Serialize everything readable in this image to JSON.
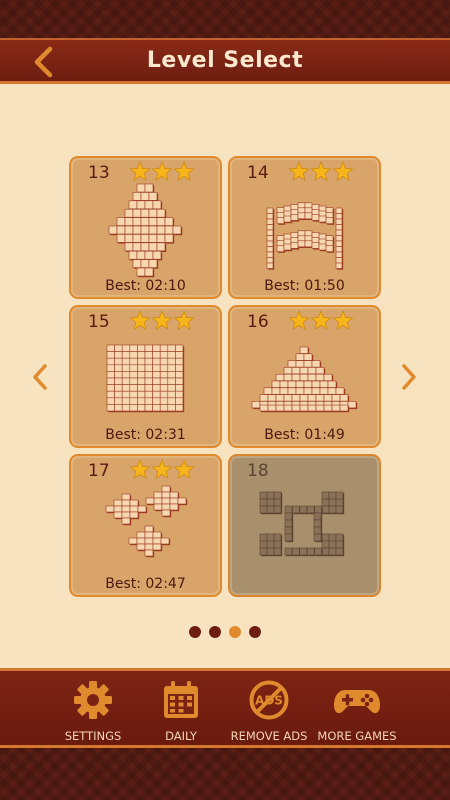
{
  "header": {
    "title": "Level Select"
  },
  "colors": {
    "accent": "#e08a2e",
    "header_bg": "#7a2214",
    "page_bg": "#f8e3c0",
    "star": "#f7b51c",
    "tile": "#f6d7b0"
  },
  "levels": [
    {
      "number": "13",
      "stars": 3,
      "best": "Best: 02:10",
      "locked": false,
      "layout": "diamond"
    },
    {
      "number": "14",
      "stars": 3,
      "best": "Best: 01:50",
      "locked": false,
      "layout": "stairs"
    },
    {
      "number": "15",
      "stars": 3,
      "best": "Best: 02:31",
      "locked": false,
      "layout": "square"
    },
    {
      "number": "16",
      "stars": 3,
      "best": "Best: 01:49",
      "locked": false,
      "layout": "pyramid"
    },
    {
      "number": "17",
      "stars": 3,
      "best": "Best: 02:47",
      "locked": false,
      "layout": "clusters"
    },
    {
      "number": "18",
      "stars": 0,
      "best": "",
      "locked": true,
      "layout": "frame"
    }
  ],
  "pagination": {
    "pages": 4,
    "current": 3
  },
  "footer": {
    "settings": "SETTINGS",
    "daily": "DAILY",
    "remove_ads": "REMOVE ADS",
    "more_games": "MORE GAMES",
    "ads_icon_text": "ADS"
  },
  "icons": [
    "back-arrow-icon",
    "left-arrow-icon",
    "right-arrow-icon",
    "gear-icon",
    "calendar-icon",
    "no-ads-icon",
    "gamepad-icon",
    "star-icon"
  ]
}
